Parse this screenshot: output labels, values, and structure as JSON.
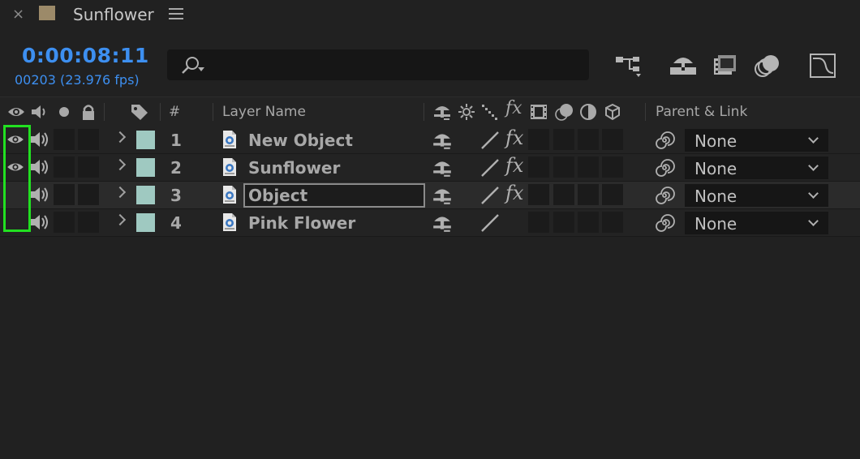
{
  "panel": {
    "close_glyph": "×",
    "title": "Sunflower",
    "swatch_color": "#9c8a69",
    "menu_icon": "hamburger-icon"
  },
  "time": {
    "timecode": "0:00:08:11",
    "frames": "00203 (23.976 fps)"
  },
  "search": {
    "placeholder": "",
    "icon": "search-icon"
  },
  "toolbar": [
    "composition-mini-flowchart-icon",
    "draft-3d-icon",
    "frame-blending-icon",
    "motion-blur-icon",
    "graph-editor-icon"
  ],
  "columns": {
    "hash": "#",
    "layer_name": "Layer Name",
    "parent_link": "Parent & Link"
  },
  "layers": [
    {
      "num": "1",
      "name": "New Object",
      "visible": true,
      "fx": true,
      "parent": "None",
      "selected": false,
      "editing": false
    },
    {
      "num": "2",
      "name": "Sunflower",
      "visible": true,
      "fx": true,
      "parent": "None",
      "selected": false,
      "editing": false
    },
    {
      "num": "3",
      "name": "Object",
      "visible": false,
      "fx": true,
      "parent": "None",
      "selected": true,
      "editing": true
    },
    {
      "num": "4",
      "name": "Pink Flower",
      "visible": false,
      "fx": false,
      "parent": "None",
      "selected": false,
      "editing": false
    }
  ],
  "colors": {
    "accent": "#3d8ff0",
    "label": "#9fc9c1",
    "highlight": "#22e021"
  }
}
